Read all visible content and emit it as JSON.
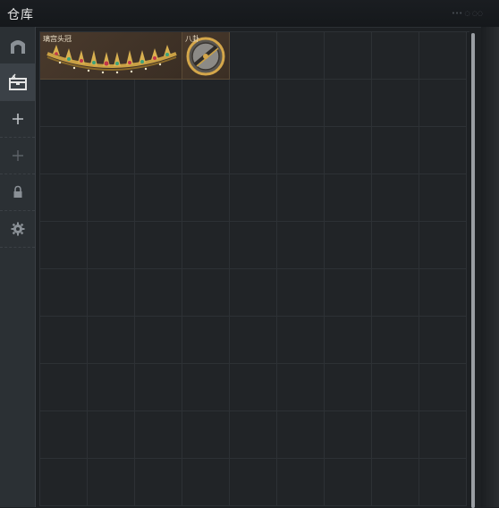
{
  "window": {
    "title": "仓库",
    "corner_text": "••• ◌ ◌◌"
  },
  "sidebar": {
    "items": [
      {
        "name": "warehouse-tab",
        "icon": "arch-icon",
        "active": false
      },
      {
        "name": "storage-tab",
        "icon": "chest-icon",
        "active": true
      },
      {
        "name": "add-tab",
        "icon": "plus-icon",
        "active": false
      },
      {
        "name": "add-tab-disabled",
        "icon": "plus-icon",
        "active": false
      },
      {
        "name": "lock-tab",
        "icon": "lock-icon",
        "active": false
      },
      {
        "name": "settings-tab",
        "icon": "gear-icon",
        "active": false
      }
    ]
  },
  "grid": {
    "columns": 9,
    "rows": 10,
    "items": [
      {
        "label": "璃宫头冠",
        "span": 3,
        "icon": "tiara-icon"
      },
      {
        "label": "八卦",
        "span": 1,
        "icon": "compass-disc-icon"
      }
    ]
  },
  "colors": {
    "item_bg": "#4a3a2c",
    "gold": "#c9a044",
    "cell_bg": "#212427"
  }
}
